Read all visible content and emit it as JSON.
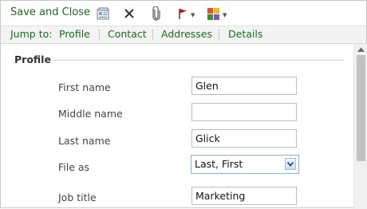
{
  "toolbar": {
    "save_close_label": "Save and Close",
    "icons": [
      "contact-card-icon",
      "delete-icon",
      "attach-icon",
      "flag-icon",
      "category-icon"
    ],
    "flag_color": "#cc1a1a"
  },
  "jump_bar": {
    "label": "Jump to:",
    "links": [
      "Profile",
      "Contact",
      "Addresses",
      "Details"
    ]
  },
  "profile": {
    "section_title": "Profile",
    "first_name": {
      "label": "First name",
      "value": "Glen"
    },
    "middle_name": {
      "label": "Middle name",
      "value": ""
    },
    "last_name": {
      "label": "Last name",
      "value": "Glick"
    },
    "file_as": {
      "label": "File as",
      "value": "Last, First"
    },
    "job_title": {
      "label": "Job title",
      "value": "Marketing"
    }
  },
  "colors": {
    "link_green": "#1e6a1e",
    "select_border": "#7eb4ea"
  }
}
